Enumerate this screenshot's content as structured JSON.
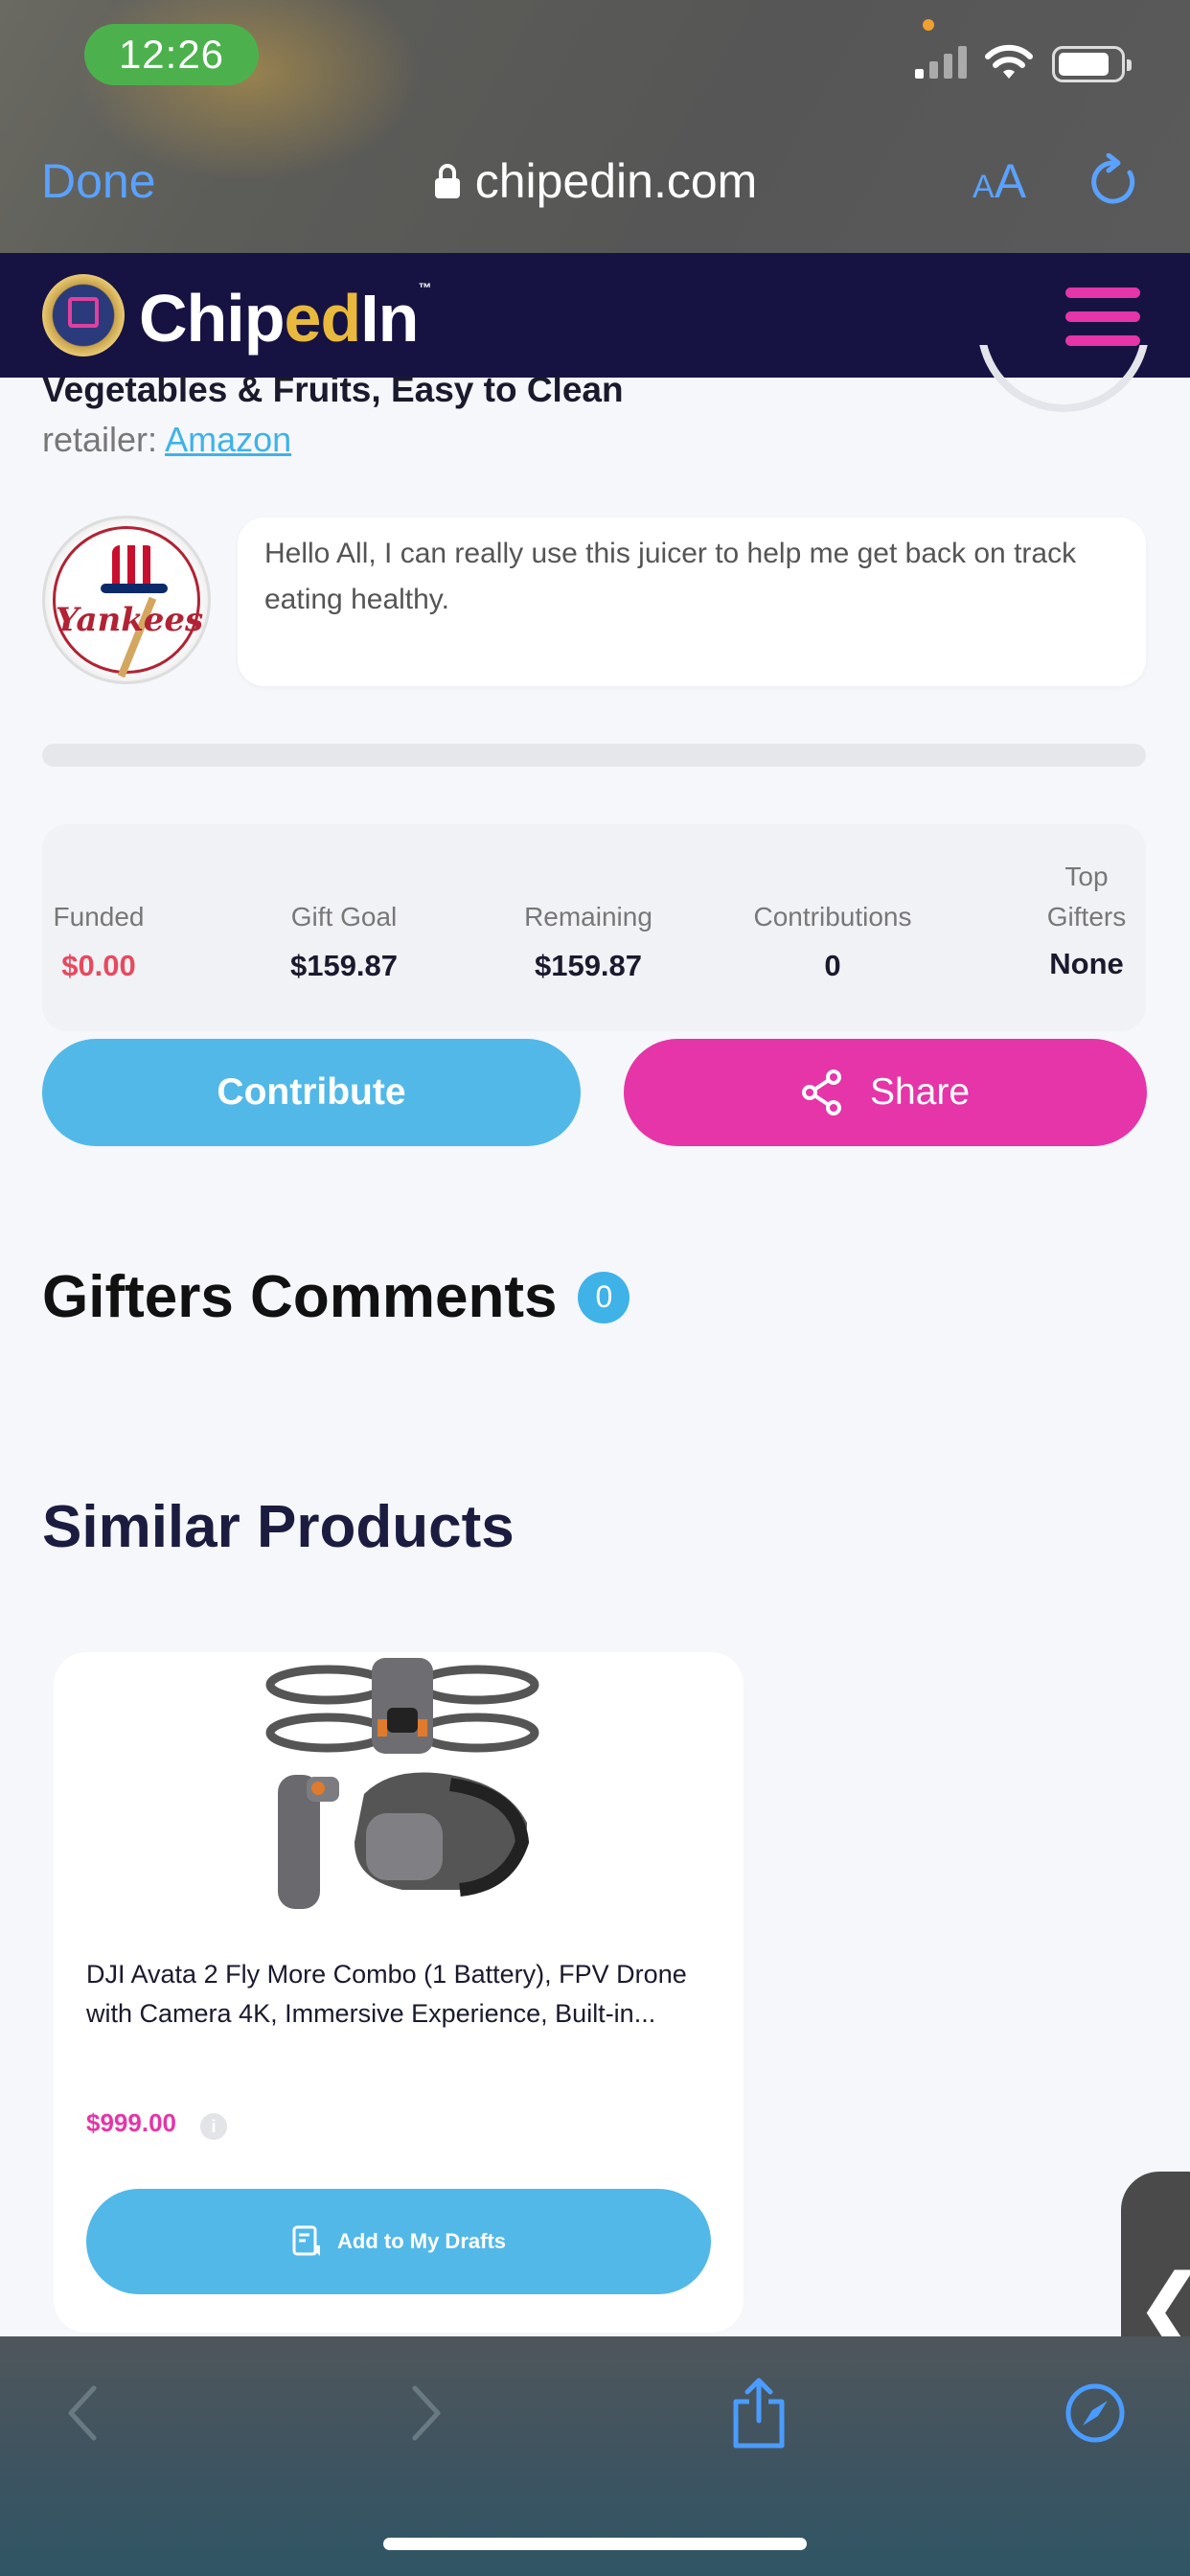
{
  "status_bar": {
    "time": "12:26"
  },
  "browser": {
    "done_label": "Done",
    "url": "chipedin.com",
    "text_size_label_small": "A",
    "text_size_label_large": "A"
  },
  "site": {
    "logo_chip": "Chip",
    "logo_ed": "ed",
    "logo_in": "In",
    "logo_tm": "™"
  },
  "product": {
    "title_tail": "Vegetables & Fruits, Easy to Clean",
    "retailer_prefix": "retailer:",
    "retailer_name": "Amazon",
    "avatar_text": "Yankees",
    "message": "Hello All, I can really use this juicer to help me get back on track eating healthy.",
    "progress_fraction": 0
  },
  "stats": {
    "funded_label": "Funded",
    "funded_value": "$0.00",
    "goal_label": "Gift Goal",
    "goal_value": "$159.87",
    "remaining_label": "Remaining",
    "remaining_value": "$159.87",
    "contributions_label": "Contributions",
    "contributions_value": "0",
    "top_gifters_label_1": "Top",
    "top_gifters_label_2": "Gifters",
    "top_gifters_value": "None"
  },
  "actions": {
    "contribute_label": "Contribute",
    "share_label": "Share"
  },
  "comments": {
    "heading": "Gifters Comments",
    "count": "0"
  },
  "similar": {
    "heading": "Similar Products",
    "items": [
      {
        "title": "DJI Avata 2 Fly More Combo (1 Battery), FPV Drone with Camera 4K, Immersive Experience, Built-in...",
        "price": "$999.00",
        "info_icon": "i",
        "button_label": "Add to My Drafts"
      }
    ]
  },
  "side_tab": {
    "glyph": "❮"
  },
  "colors": {
    "accent_blue": "#52b8e8",
    "accent_pink": "#e535a8",
    "header_navy": "#161343",
    "funded_red": "#e8495f"
  },
  "icons": [
    "lock-icon",
    "reload-icon",
    "hamburger-menu-icon",
    "share-icon",
    "drafts-icon",
    "info-icon",
    "back-arrow-icon",
    "forward-arrow-icon",
    "safari-share-icon",
    "compass-icon"
  ]
}
